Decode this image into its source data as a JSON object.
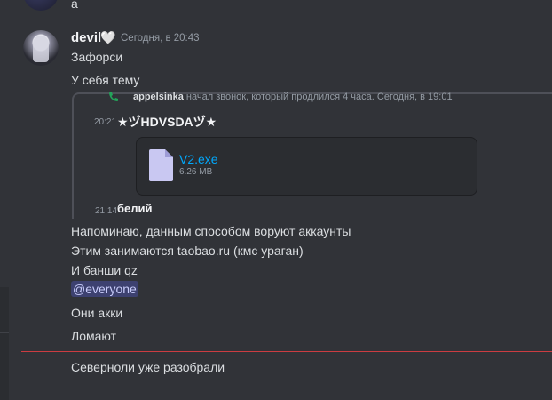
{
  "top_message": {
    "text": "a"
  },
  "message": {
    "username": "devil",
    "heart": "🤍",
    "timestamp": "Сегодня, в 20:43",
    "lines": [
      "Зафорси",
      "У себя тему"
    ],
    "forward": {
      "call_user": "appelsinka",
      "call_text": " начал звонок, который продлился 4 часа.",
      "call_time": "Сегодня, в 19:01",
      "msg1_time": "20:21",
      "msg1_text": "★ヅHDVSDAヅ★",
      "file": {
        "name": "V2.exe",
        "size": "6.26 MB"
      },
      "msg2_time": "21:14",
      "msg2_text": "белий"
    },
    "body": [
      "Напоминаю, данным способом воруют аккаунты",
      "Этим занимаются taobao.ru (кмс ураган)",
      "И банши qz"
    ],
    "mention": "@everyone",
    "after": [
      "Они акки",
      "Ломают"
    ]
  },
  "new_message": {
    "text": "Северноли уже разобрали"
  },
  "colors": {
    "background": "#313338",
    "link": "#00a8fc",
    "mention_bg": "#5865f24d",
    "new_divider": "#f23f43"
  }
}
